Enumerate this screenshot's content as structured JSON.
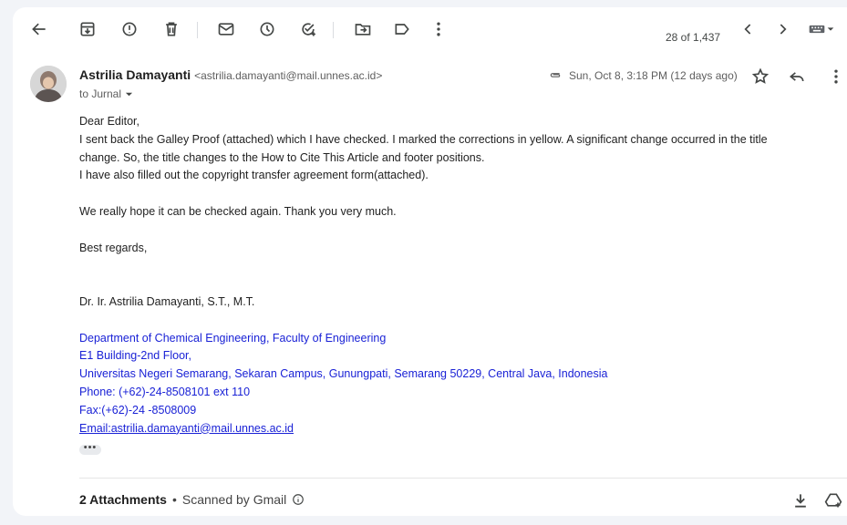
{
  "toolbar": {
    "icons": [
      "back-arrow-icon",
      "archive-icon",
      "report-spam-icon",
      "delete-icon",
      "mark-unread-icon",
      "snooze-icon",
      "add-task-icon",
      "move-to-icon",
      "label-icon",
      "more-vert-icon"
    ],
    "pagination": "28 of 1,437",
    "prev_icon": "chevron-left-icon",
    "next_icon": "chevron-right-icon",
    "input_tools_icon": "keyboard-icon"
  },
  "message": {
    "sender_name": "Astrilia Damayanti",
    "sender_email": "<astrilia.damayanti@mail.unnes.ac.id>",
    "to_label": "to Jurnal",
    "date": "Sun, Oct 8, 3:18 PM (12 days ago)",
    "body_lines": [
      "Dear Editor,",
      "I sent back the Galley Proof (attached) which I have checked. I marked the corrections in yellow. A significant change occurred in the title",
      "change. So, the title changes to the How to Cite This Article and footer positions.",
      "I have also filled out the copyright transfer agreement form(attached).",
      "We really hope it can be checked again. Thank you very much.",
      "Best regards,",
      "Dr. Ir. Astrilia Damayanti, S.T., M.T."
    ],
    "signature": [
      "Department of Chemical Engineering, Faculty of Engineering",
      "E1 Building-2nd Floor,",
      "Universitas Negeri Semarang, Sekaran Campus, Gunungpati, Semarang 50229, Central Java, Indonesia",
      "Phone: (+62)-24-8508101 ext 110",
      "Fax:(+62)-24 -8508009",
      "Email:astrilia.damayanti@mail.unnes.ac.id"
    ],
    "trimmed": "•••"
  },
  "attachments": {
    "count_label": "2 Attachments",
    "separator": "•",
    "scan_label": "Scanned by Gmail"
  },
  "colors": {
    "signature": "#1a22d6",
    "background": "#f2f4f8"
  }
}
